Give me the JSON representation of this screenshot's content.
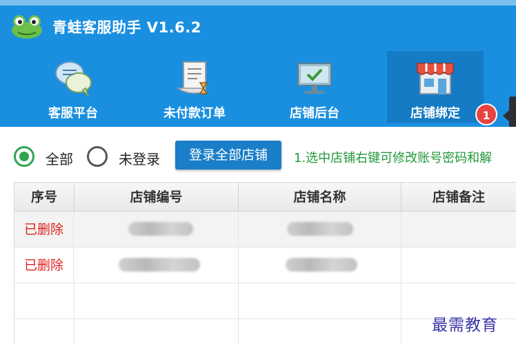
{
  "app": {
    "title": "青蛙客服助手 V1.6.2",
    "logo_icon": "frog-logo-icon",
    "colors": {
      "primary": "#1a8fe0",
      "active_tab": "#157bc4",
      "success": "#2ea44f",
      "danger": "#e0201f"
    }
  },
  "toolbar": {
    "items": [
      {
        "label": "客服平台",
        "icon": "chat-bubbles-icon",
        "active": false
      },
      {
        "label": "未付款订单",
        "icon": "order-hourglass-icon",
        "active": false
      },
      {
        "label": "店铺后台",
        "icon": "monitor-check-icon",
        "active": false
      },
      {
        "label": "店铺绑定",
        "icon": "storefront-icon",
        "active": true
      }
    ],
    "badge": "1"
  },
  "filter": {
    "options": [
      {
        "label": "全部",
        "checked": true
      },
      {
        "label": "未登录",
        "checked": false
      }
    ],
    "login_all_button": "登录全部店铺",
    "hint": "1.选中店铺右键可修改账号密码和解"
  },
  "table": {
    "columns": [
      "序号",
      "店铺编号",
      "店铺名称",
      "店铺备注"
    ],
    "rows": [
      {
        "status": "已删除"
      },
      {
        "status": "已删除"
      },
      {
        "status": ""
      },
      {
        "status": ""
      }
    ]
  },
  "watermark": "最需教育"
}
